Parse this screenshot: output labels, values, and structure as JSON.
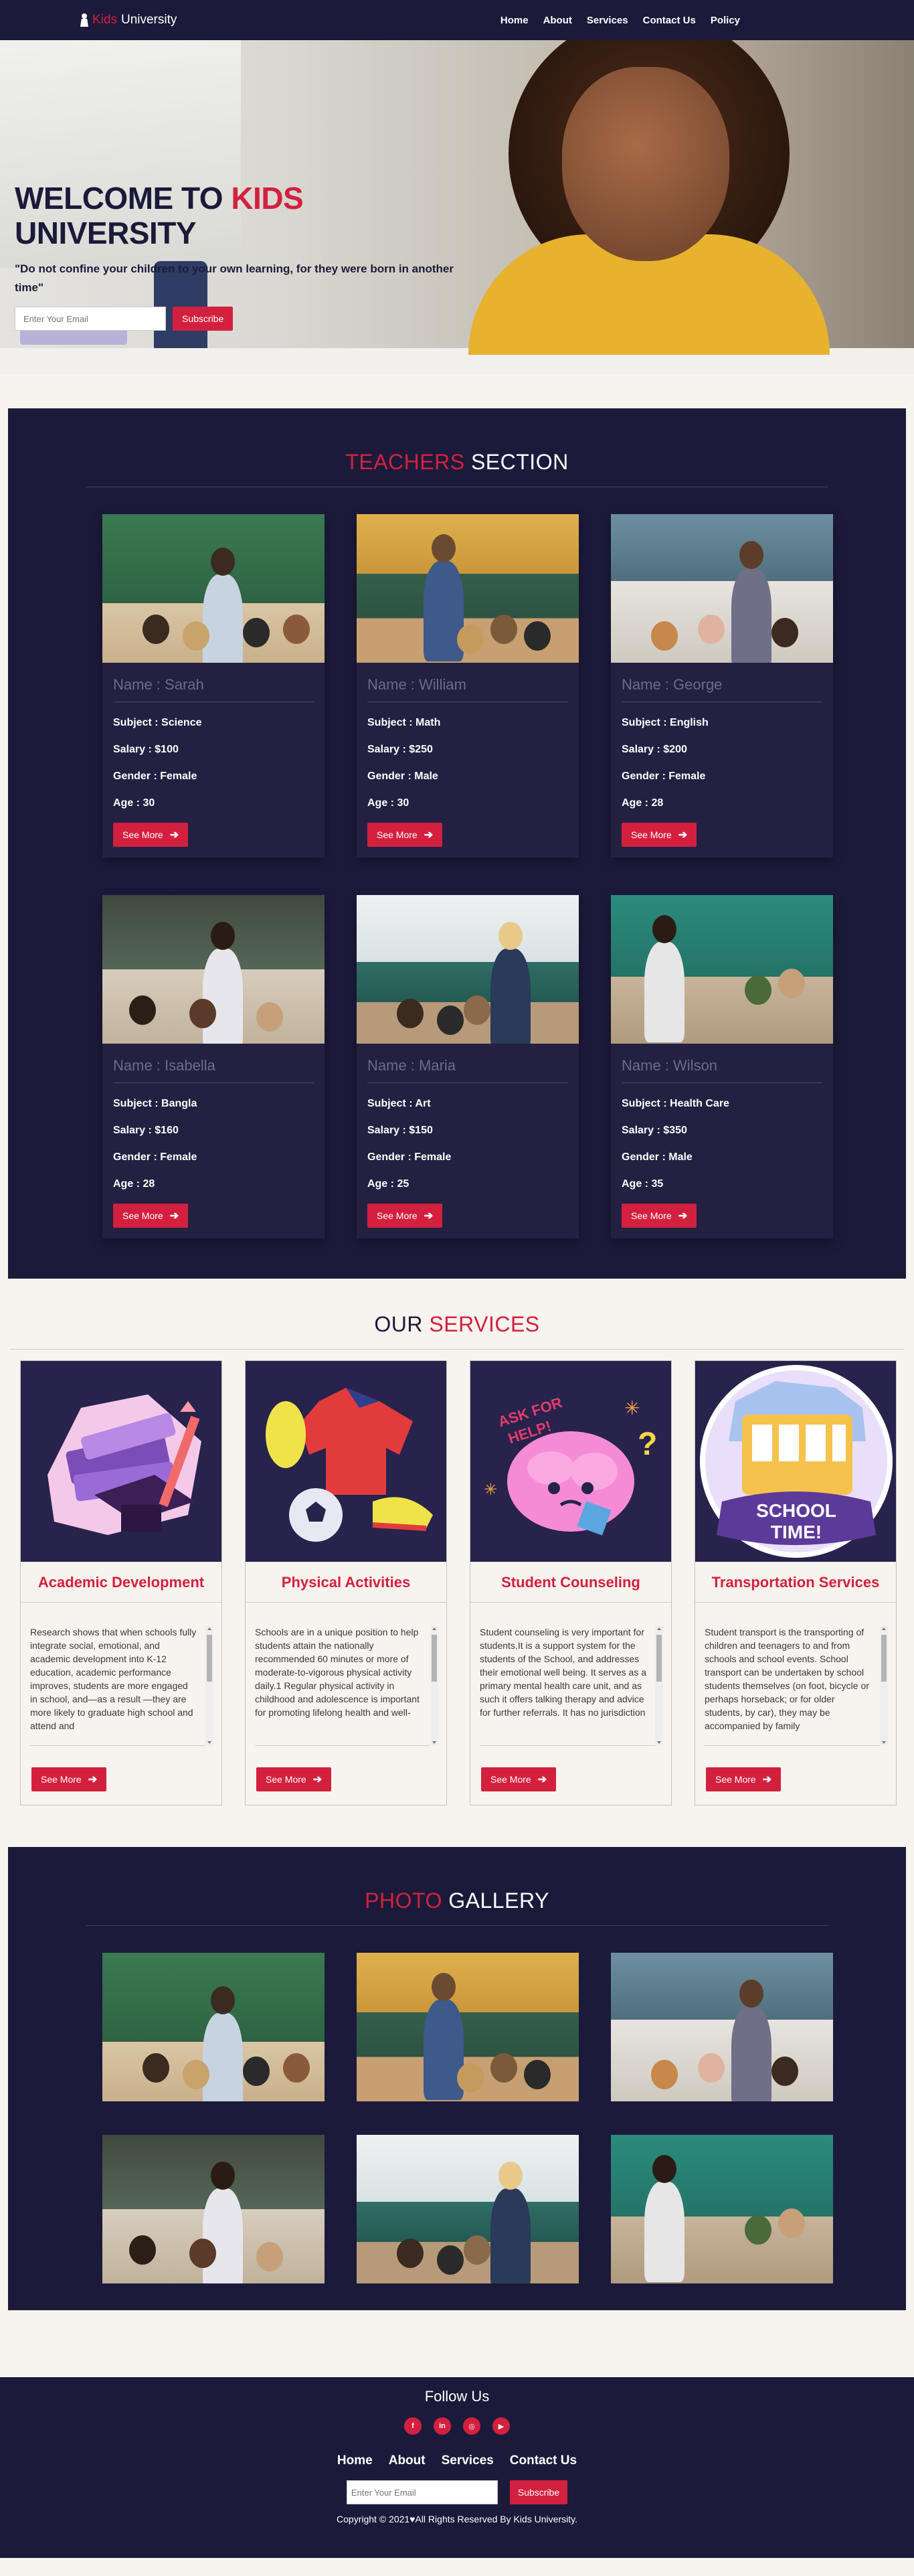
{
  "nav": {
    "brand_accent": "Kids",
    "brand_rest": "University",
    "links": [
      "Home",
      "About",
      "Services",
      "Contact Us",
      "Policy"
    ]
  },
  "hero": {
    "title_part1": "WELCOME TO ",
    "title_accent": "KIDS",
    "title_part2": "UNIVERSITY",
    "quote": "\"Do not confine your children to your own learning, for they were born in another time\"",
    "email_placeholder": "Enter Your Email",
    "subscribe_label": "Subscribe"
  },
  "teachers": {
    "title_accent": "TEACHERS",
    "title_rest": " SECTION",
    "subject_label": "Subject : ",
    "salary_label": "Salary : ",
    "gender_label": "Gender : ",
    "age_label": "Age : ",
    "name_label": "Name : ",
    "button_label": "See More",
    "items": [
      {
        "name": "Sarah",
        "subject": "Science",
        "salary": "$100",
        "gender": "Female",
        "age": "30"
      },
      {
        "name": "William",
        "subject": "Math",
        "salary": "$250",
        "gender": "Male",
        "age": "30"
      },
      {
        "name": "George",
        "subject": "English",
        "salary": "$200",
        "gender": "Female",
        "age": "28"
      },
      {
        "name": "Isabella",
        "subject": "Bangla",
        "salary": "$160",
        "gender": "Female",
        "age": "28"
      },
      {
        "name": "Maria",
        "subject": "Art",
        "salary": "$150",
        "gender": "Female",
        "age": "25"
      },
      {
        "name": "Wilson",
        "subject": "Health Care",
        "salary": "$350",
        "gender": "Male",
        "age": "35"
      }
    ]
  },
  "services": {
    "title_rest": "OUR ",
    "title_accent": "SERVICES",
    "button_label": "See More",
    "items": [
      {
        "title": "Academic Development",
        "text": "Research shows that when schools fully integrate social, emotional, and academic development into K-12 education, academic performance improves, students are more engaged in school, and—as a result —they are more likely to graduate high school and attend and"
      },
      {
        "title": "Physical Activities",
        "text": "Schools are in a unique position to help students attain the nationally recommended 60 minutes or more of moderate-to-vigorous physical activity daily.1 Regular physical activity in childhood and adolescence is important for promoting lifelong health and well-"
      },
      {
        "title": "Student Counseling",
        "text": "Student counseling is very important for students.It is a support system for the students of the School, and addresses their emotional well being. It serves as a primary mental health care unit, and as such it offers talking therapy and advice for further referrals. It has no jurisdiction"
      },
      {
        "title": "Transportation Services",
        "text": "Student transport is the transporting of children and teenagers to and from schools and school events. School transport can be undertaken by school students themselves (on foot, bicycle or perhaps horseback; or for older students, by car), they may be accompanied by family"
      }
    ]
  },
  "gallery": {
    "title_accent": "PHOTO",
    "title_rest": " GALLERY"
  },
  "footer": {
    "title": "Follow Us",
    "social_icons": [
      "facebook-icon",
      "linkedin-icon",
      "instagram-icon",
      "youtube-icon"
    ],
    "links": [
      "Home",
      "About",
      "Services",
      "Contact Us"
    ],
    "email_placeholder": "Enter Your Email",
    "subscribe_label": "Subscribe",
    "copyright_pre": "Copyright © 2021",
    "copyright_post": "All Rights Reserved By Kids University."
  },
  "colors": {
    "navy": "#1c1a3a",
    "accent": "#d3203f",
    "background": "#f7f3ee"
  }
}
